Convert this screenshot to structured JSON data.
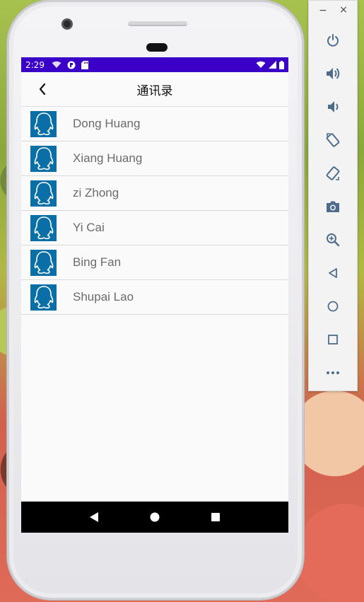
{
  "status_bar": {
    "time": "2:29"
  },
  "app_bar": {
    "title": "通讯录"
  },
  "contacts": [
    {
      "name": "Dong Huang"
    },
    {
      "name": "Xiang Huang"
    },
    {
      "name": "zi Zhong"
    },
    {
      "name": "Yi Cai"
    },
    {
      "name": "Bing Fan"
    },
    {
      "name": "Shupai Lao"
    }
  ],
  "emulator_panel": {
    "window_controls": {
      "minimize": "−",
      "close": "×"
    },
    "buttons": [
      "power-icon",
      "volume-up-icon",
      "volume-down-icon",
      "rotate-left-icon",
      "rotate-right-icon",
      "camera-icon",
      "zoom-icon",
      "back-icon",
      "home-icon",
      "overview-icon",
      "more-icon"
    ]
  },
  "colors": {
    "status_bar": "#3b00c8",
    "avatar": "#0a6fa6",
    "nav_bar": "#000000"
  }
}
